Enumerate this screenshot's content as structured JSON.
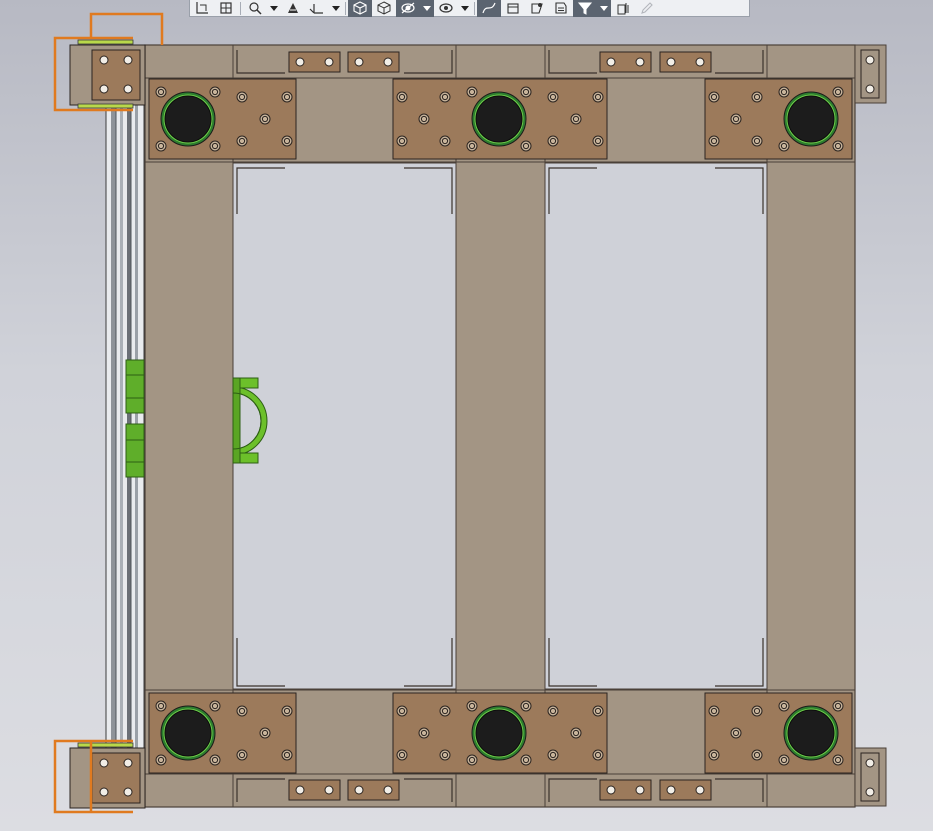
{
  "app": {
    "view": "cad-3d-viewport",
    "background_top": "#b7b9c3",
    "background_bottom": "#dcdde2"
  },
  "colors": {
    "frame": "#a39584",
    "frame_edge": "#4a4038",
    "plate": "#9c7a5b",
    "hole": "#1a1a1a",
    "ring": "#3aa13a",
    "clamp": "#6cc02a",
    "orange": "#e07a1f",
    "rail": "#8a8f96",
    "toolbar_bg": "#eef0f3",
    "toolbar_active": "#5b6470"
  },
  "toolbar": {
    "buttons": [
      {
        "icon": "section-view-icon",
        "active": false
      },
      {
        "icon": "view-orientation-icon",
        "active": false
      },
      {
        "icon": "zoom-area-icon",
        "active": false,
        "dropdown": true
      },
      {
        "icon": "rotate-view-icon",
        "active": false
      },
      {
        "icon": "axes-triad-icon",
        "active": false,
        "dropdown": true
      },
      {
        "icon": "shaded-cube-icon",
        "active": true
      },
      {
        "icon": "wireframe-cube-icon",
        "active": false
      },
      {
        "icon": "hide-show-icon",
        "active": true,
        "dropdown": true
      },
      {
        "icon": "display-eye-icon",
        "active": false,
        "dropdown": true
      },
      {
        "icon": "curves-toggle-icon",
        "active": true
      },
      {
        "icon": "sketch-toggle-icon",
        "active": false
      },
      {
        "icon": "points-toggle-icon",
        "active": false
      },
      {
        "icon": "dimensions-toggle-icon",
        "active": false
      },
      {
        "icon": "filter-icon",
        "active": true,
        "dropdown": true
      },
      {
        "icon": "layers-icon",
        "active": false
      },
      {
        "icon": "pencil-icon",
        "active": false,
        "disabled": true
      }
    ]
  }
}
